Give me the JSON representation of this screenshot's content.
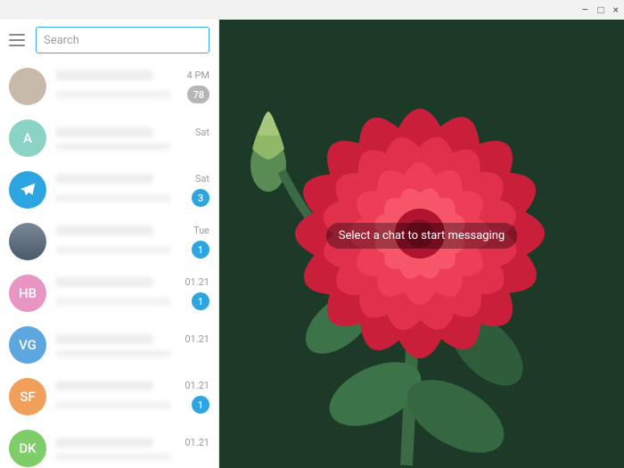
{
  "window": {
    "min": "–",
    "max": "□",
    "close": "×"
  },
  "search": {
    "placeholder": "Search"
  },
  "chats": [
    {
      "avatar_type": "photo",
      "initials": "",
      "date": "4 PM",
      "badge": "78",
      "badge_style": "gray"
    },
    {
      "avatar_type": "a",
      "initials": "A",
      "date": "Sat",
      "badge": "",
      "badge_style": ""
    },
    {
      "avatar_type": "tg",
      "initials": "",
      "date": "Sat",
      "badge": "3",
      "badge_style": "blue"
    },
    {
      "avatar_type": "photo2",
      "initials": "",
      "date": "Tue",
      "badge": "1",
      "badge_style": "blue"
    },
    {
      "avatar_type": "hb",
      "initials": "HB",
      "date": "01.21",
      "badge": "1",
      "badge_style": "blue"
    },
    {
      "avatar_type": "vg",
      "initials": "VG",
      "date": "01.21",
      "badge": "",
      "badge_style": ""
    },
    {
      "avatar_type": "sf",
      "initials": "SF",
      "date": "01.21",
      "badge": "1",
      "badge_style": "blue"
    },
    {
      "avatar_type": "dk",
      "initials": "DK",
      "date": "01.21",
      "badge": "",
      "badge_style": ""
    }
  ],
  "empty_state": "Select a chat to start messaging"
}
